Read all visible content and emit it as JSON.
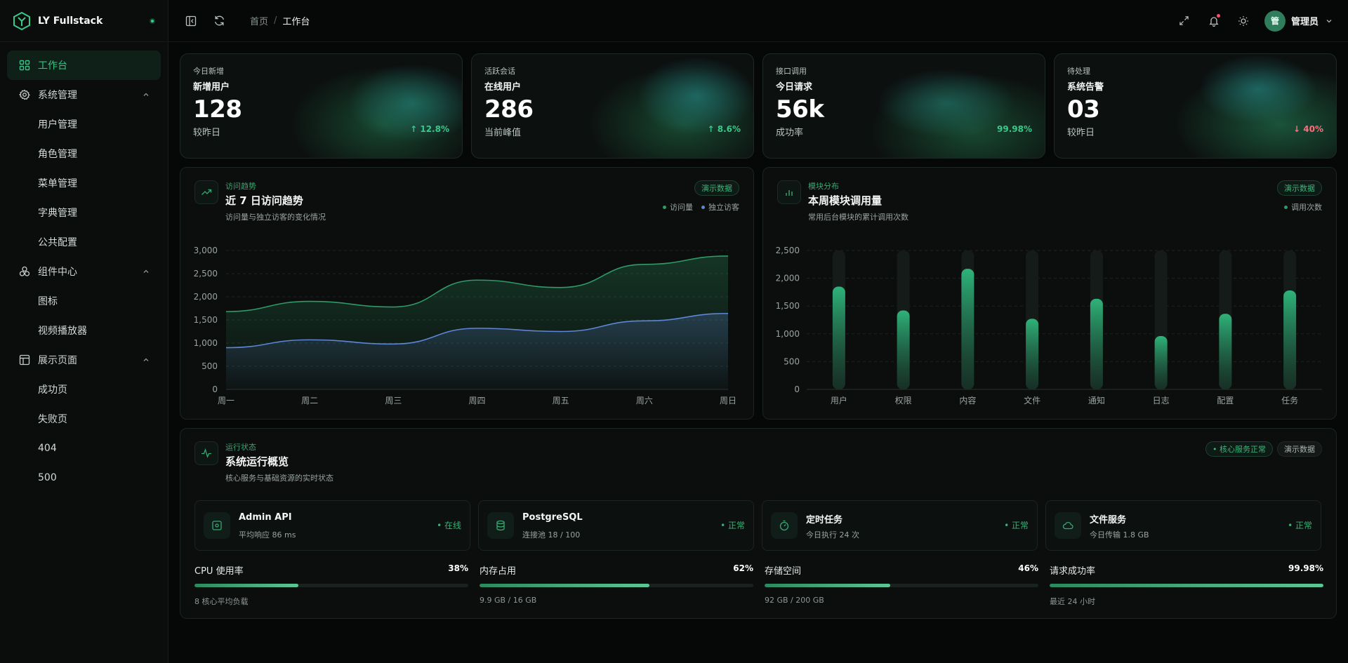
{
  "brand": {
    "name": "LY Fullstack"
  },
  "sidebar": {
    "items": [
      {
        "label": "工作台",
        "icon": "dashboard-icon",
        "active": true
      },
      {
        "label": "系统管理",
        "icon": "gear-icon",
        "children": [
          "用户管理",
          "角色管理",
          "菜单管理",
          "字典管理",
          "公共配置"
        ]
      },
      {
        "label": "组件中心",
        "icon": "components-icon",
        "children": [
          "图标",
          "视频播放器"
        ]
      },
      {
        "label": "展示页面",
        "icon": "layout-icon",
        "children": [
          "成功页",
          "失败页",
          "404",
          "500"
        ]
      }
    ]
  },
  "header": {
    "breadcrumb": [
      "首页",
      "工作台"
    ],
    "breadcrumb_sep": "/",
    "user": {
      "avatar": "管",
      "name": "管理员"
    }
  },
  "stats": [
    {
      "tag": "今日新增",
      "title": "新增用户",
      "value": "128",
      "sub": "较昨日",
      "trend": "↑ 12.8%",
      "trend_color": "#37c98a"
    },
    {
      "tag": "活跃会话",
      "title": "在线用户",
      "value": "286",
      "sub": "当前峰值",
      "trend": "↑ 8.6%",
      "trend_color": "#37c98a"
    },
    {
      "tag": "接口调用",
      "title": "今日请求",
      "value": "56k",
      "sub": "成功率",
      "trend": "99.98%",
      "trend_color": "#37c98a"
    },
    {
      "tag": "待处理",
      "title": "系统告警",
      "value": "03",
      "sub": "较昨日",
      "trend": "↓ 40%",
      "trend_color": "#ff6b7d"
    }
  ],
  "trend_panel": {
    "kicker": "访问趋势",
    "title": "近 7 日访问趋势",
    "desc": "访问量与独立访客的变化情况",
    "badge": "演示数据",
    "legend": [
      "访问量",
      "独立访客"
    ]
  },
  "module_panel": {
    "kicker": "模块分布",
    "title": "本周模块调用量",
    "desc": "常用后台模块的累计调用次数",
    "badge": "演示数据",
    "legend": [
      "调用次数"
    ]
  },
  "chart_data": [
    {
      "type": "area",
      "categories": [
        "周一",
        "周二",
        "周三",
        "周四",
        "周五",
        "周六",
        "周日"
      ],
      "series": [
        {
          "name": "访问量",
          "values": [
            1680,
            1900,
            1780,
            2360,
            2200,
            2700,
            2880
          ],
          "color": "#2f9a68"
        },
        {
          "name": "独立访客",
          "values": [
            900,
            1070,
            980,
            1320,
            1250,
            1480,
            1640
          ],
          "color": "#5e86d6"
        }
      ],
      "ylim": [
        0,
        3000
      ],
      "yticks": [
        "3,000",
        "2,500",
        "2,000",
        "1,500",
        "1,000",
        "500",
        "0"
      ],
      "grid": true
    },
    {
      "type": "bar",
      "categories": [
        "用户",
        "权限",
        "内容",
        "文件",
        "通知",
        "日志",
        "配置",
        "任务"
      ],
      "series": [
        {
          "name": "调用次数",
          "values": [
            1850,
            1420,
            2170,
            1270,
            1630,
            960,
            1360,
            1780
          ],
          "color": "#2fa873"
        }
      ],
      "ylim": [
        0,
        2500
      ],
      "yticks": [
        "2,500",
        "2,000",
        "1,500",
        "1,000",
        "500",
        "0"
      ],
      "grid": true
    }
  ],
  "status_panel": {
    "kicker": "运行状态",
    "title": "系统运行概览",
    "desc": "核心服务与基础资源的实时状态",
    "badge_ok": "• 核心服务正常",
    "badge_demo": "演示数据",
    "services": [
      {
        "name": "Admin API",
        "desc": "平均响应 86 ms",
        "status": "• 在线",
        "icon": "api-icon"
      },
      {
        "name": "PostgreSQL",
        "desc": "连接池 18 / 100",
        "status": "• 正常",
        "icon": "database-icon"
      },
      {
        "name": "定时任务",
        "desc": "今日执行 24 次",
        "status": "• 正常",
        "icon": "timer-icon"
      },
      {
        "name": "文件服务",
        "desc": "今日传输 1.8 GB",
        "status": "• 正常",
        "icon": "cloud-icon"
      }
    ],
    "meters": [
      {
        "label": "CPU 使用率",
        "value": "38%",
        "percent": 38,
        "desc": "8 核心平均负载"
      },
      {
        "label": "内存占用",
        "value": "62%",
        "percent": 62,
        "desc": "9.9 GB / 16 GB"
      },
      {
        "label": "存储空间",
        "value": "46%",
        "percent": 46,
        "desc": "92 GB / 200 GB"
      },
      {
        "label": "请求成功率",
        "value": "99.98%",
        "percent": 99.98,
        "desc": "最近 24 小时"
      }
    ]
  }
}
